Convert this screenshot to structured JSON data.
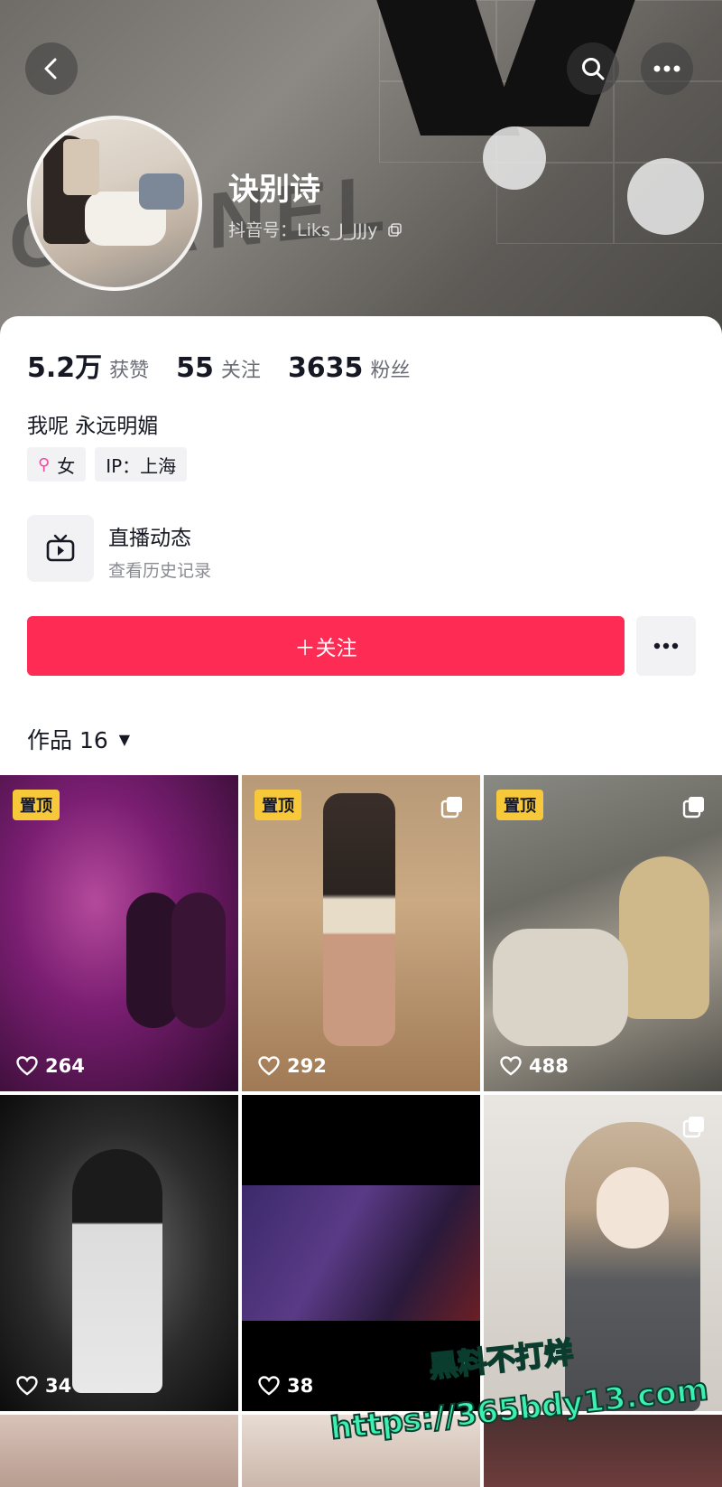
{
  "profile": {
    "username": "诀别诗",
    "douyin_id": "抖音号：Liks_J_JJJy",
    "bio": "我呢 永远明媚"
  },
  "stats": [
    {
      "num": "5.2万",
      "label": "获赞"
    },
    {
      "num": "55",
      "label": "关注"
    },
    {
      "num": "3635",
      "label": "粉丝"
    }
  ],
  "tags": {
    "gender": "女",
    "ip": "IP：上海"
  },
  "live": {
    "title": "直播动态",
    "subtitle": "查看历史记录"
  },
  "actions": {
    "follow_label": "＋关注"
  },
  "works": {
    "label": "作品 16",
    "items": [
      {
        "pinned_label": "置顶",
        "likes": "264"
      },
      {
        "pinned_label": "置顶",
        "likes": "292"
      },
      {
        "pinned_label": "置顶",
        "likes": "488"
      },
      {
        "pinned_label": "",
        "likes": "34"
      },
      {
        "pinned_label": "",
        "likes": "38"
      },
      {
        "pinned_label": "",
        "likes": ""
      }
    ]
  },
  "background": {
    "brand_text": "CHANEL"
  },
  "watermark": {
    "line1": "黑料不打烊",
    "line2": "https://365bdy13.com"
  },
  "colors": {
    "accent": "#fe2c55",
    "pin": "#f7c93a"
  }
}
